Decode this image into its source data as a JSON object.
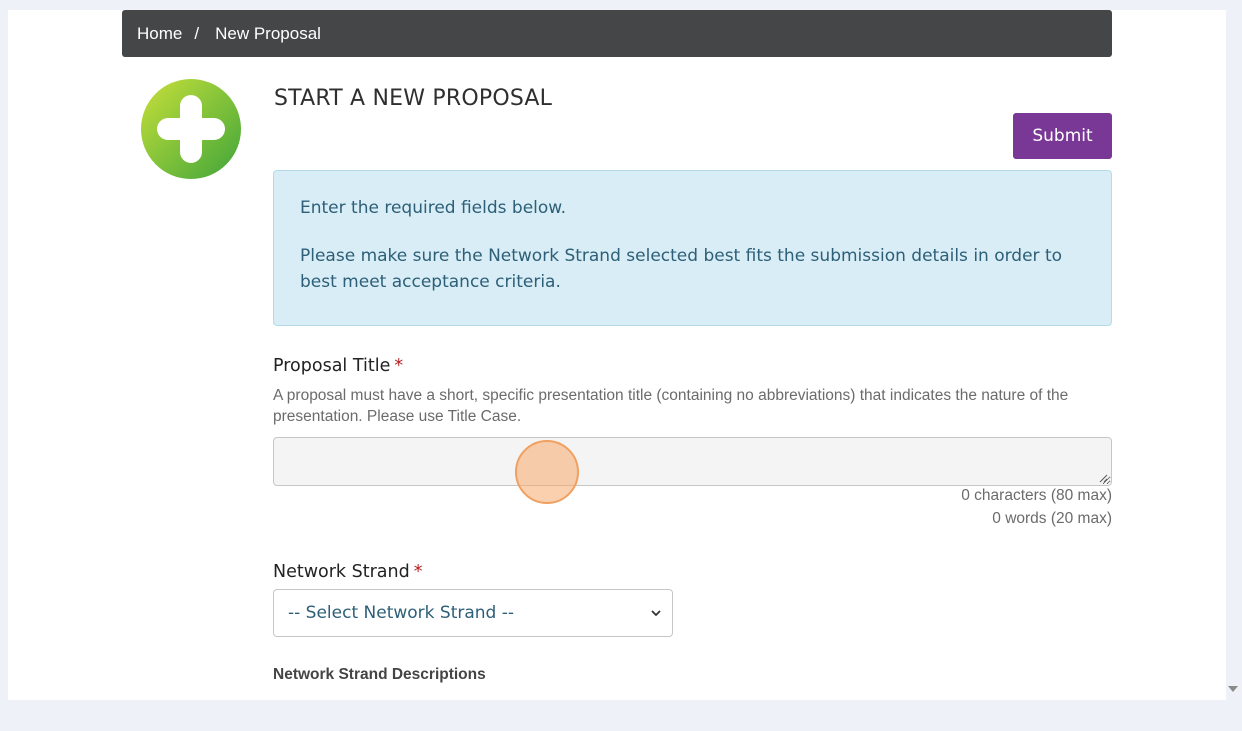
{
  "breadcrumb": {
    "home": "Home",
    "separator": "/",
    "current": "New Proposal"
  },
  "page": {
    "title": "START A NEW PROPOSAL",
    "logo_icon": "plus-circle-icon"
  },
  "actions": {
    "submit_label": "Submit"
  },
  "alert": {
    "line1": "Enter the required fields below.",
    "line2": "Please make sure the Network Strand selected best fits the submission details in order to best meet acceptance criteria."
  },
  "proposal_title": {
    "label": "Proposal Title",
    "required_mark": "*",
    "help": "A proposal must have a short, specific presentation title (containing no abbreviations) that indicates the nature of the presentation. Please use Title Case.",
    "value": "",
    "char_count": "0 characters (80 max)",
    "word_count": "0 words (20 max)"
  },
  "network_strand": {
    "label": "Network Strand",
    "required_mark": "*",
    "selected": "-- Select Network Strand --",
    "descriptions_heading": "Network Strand Descriptions"
  },
  "colors": {
    "breadcrumb_bg": "#454648",
    "submit_bg": "#7a3896",
    "alert_bg": "#d8edf5",
    "alert_text": "#2d5f78",
    "required": "#b41e1e",
    "logo_green": "#7cc23a"
  }
}
